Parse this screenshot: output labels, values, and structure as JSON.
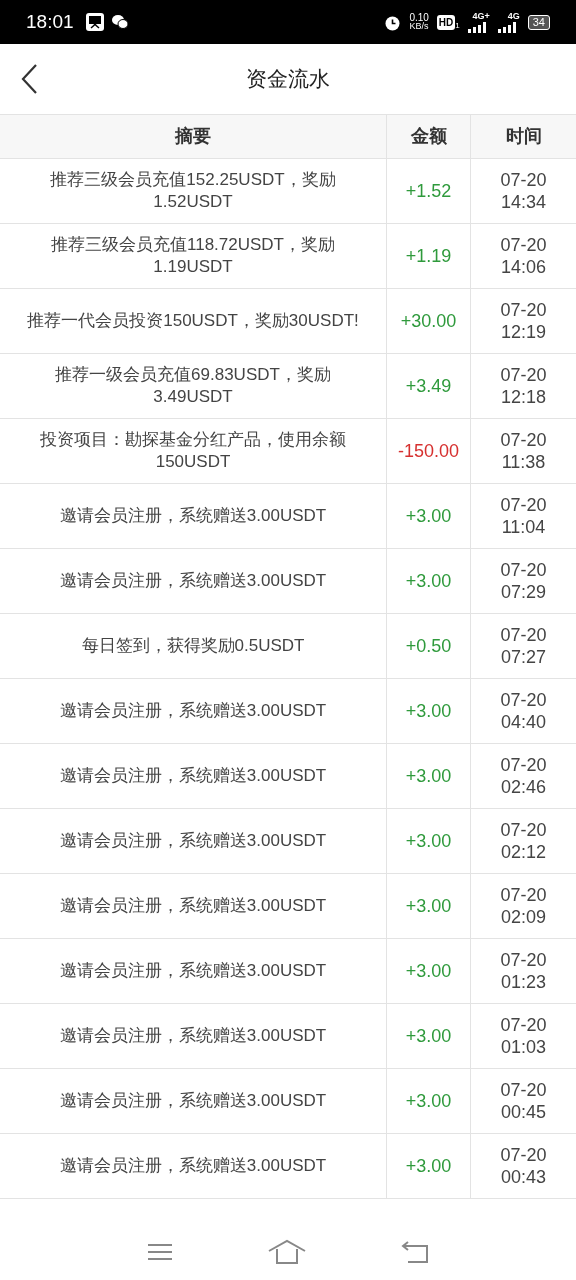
{
  "status_bar": {
    "time": "18:01",
    "net_speed": "0.10",
    "net_unit": "KB/s",
    "hd": "HD",
    "hd_sub": "1",
    "sim1": "4G+",
    "sim2": "4G",
    "battery": "34"
  },
  "header": {
    "title": "资金流水"
  },
  "table": {
    "columns": [
      "摘要",
      "金额",
      "时间"
    ],
    "rows": [
      {
        "summary": "推荐三级会员充值152.25USDT，奖励1.52USDT",
        "amount": "+1.52",
        "kind": "credit",
        "date": "07-20",
        "time": "14:34"
      },
      {
        "summary": "推荐三级会员充值118.72USDT，奖励1.19USDT",
        "amount": "+1.19",
        "kind": "credit",
        "date": "07-20",
        "time": "14:06"
      },
      {
        "summary": "推荐一代会员投资150USDT，奖励30USDT!",
        "amount": "+30.00",
        "kind": "credit",
        "date": "07-20",
        "time": "12:19"
      },
      {
        "summary": "推荐一级会员充值69.83USDT，奖励3.49USDT",
        "amount": "+3.49",
        "kind": "credit",
        "date": "07-20",
        "time": "12:18"
      },
      {
        "summary": "投资项目：勘探基金分红产品，使用余额150USDT",
        "amount": "-150.00",
        "kind": "debit",
        "date": "07-20",
        "time": "11:38"
      },
      {
        "summary": "邀请会员注册，系统赠送3.00USDT",
        "amount": "+3.00",
        "kind": "credit",
        "date": "07-20",
        "time": "11:04"
      },
      {
        "summary": "邀请会员注册，系统赠送3.00USDT",
        "amount": "+3.00",
        "kind": "credit",
        "date": "07-20",
        "time": "07:29"
      },
      {
        "summary": "每日签到，获得奖励0.5USDT",
        "amount": "+0.50",
        "kind": "credit",
        "date": "07-20",
        "time": "07:27"
      },
      {
        "summary": "邀请会员注册，系统赠送3.00USDT",
        "amount": "+3.00",
        "kind": "credit",
        "date": "07-20",
        "time": "04:40"
      },
      {
        "summary": "邀请会员注册，系统赠送3.00USDT",
        "amount": "+3.00",
        "kind": "credit",
        "date": "07-20",
        "time": "02:46"
      },
      {
        "summary": "邀请会员注册，系统赠送3.00USDT",
        "amount": "+3.00",
        "kind": "credit",
        "date": "07-20",
        "time": "02:12"
      },
      {
        "summary": "邀请会员注册，系统赠送3.00USDT",
        "amount": "+3.00",
        "kind": "credit",
        "date": "07-20",
        "time": "02:09"
      },
      {
        "summary": "邀请会员注册，系统赠送3.00USDT",
        "amount": "+3.00",
        "kind": "credit",
        "date": "07-20",
        "time": "01:23"
      },
      {
        "summary": "邀请会员注册，系统赠送3.00USDT",
        "amount": "+3.00",
        "kind": "credit",
        "date": "07-20",
        "time": "01:03"
      },
      {
        "summary": "邀请会员注册，系统赠送3.00USDT",
        "amount": "+3.00",
        "kind": "credit",
        "date": "07-20",
        "time": "00:45"
      },
      {
        "summary": "邀请会员注册，系统赠送3.00USDT",
        "amount": "+3.00",
        "kind": "credit",
        "date": "07-20",
        "time": "00:43"
      }
    ]
  }
}
